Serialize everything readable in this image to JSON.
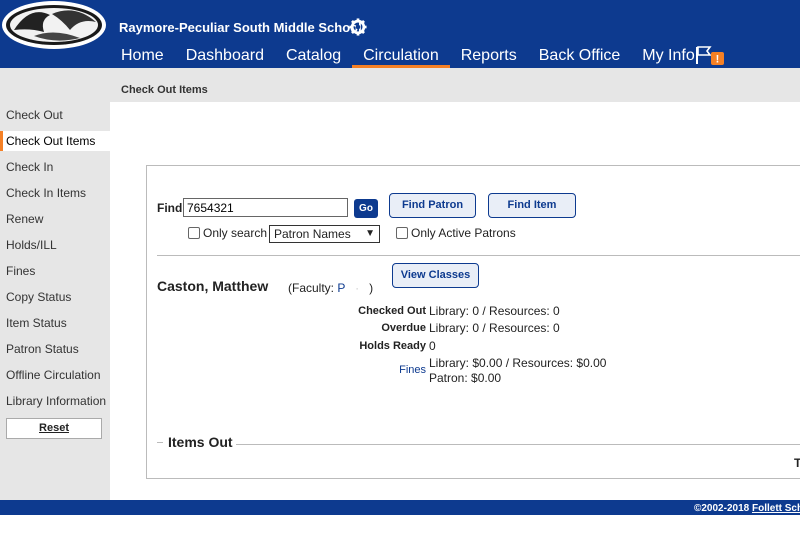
{
  "header": {
    "school_name": "Raymore-Peculiar South Middle School",
    "nav": [
      {
        "label": "Home"
      },
      {
        "label": "Dashboard"
      },
      {
        "label": "Catalog"
      },
      {
        "label": "Circulation"
      },
      {
        "label": "Reports"
      },
      {
        "label": "Back Office"
      },
      {
        "label": "My Info"
      }
    ],
    "active_nav": "Circulation",
    "alert_badge": "!"
  },
  "breadcrumb": "Check Out Items",
  "sidebar": {
    "items": [
      {
        "label": "Check Out"
      },
      {
        "label": "Check Out Items"
      },
      {
        "label": "Check In"
      },
      {
        "label": "Check In Items"
      },
      {
        "label": "Renew"
      },
      {
        "label": "Holds/ILL"
      },
      {
        "label": "Fines"
      },
      {
        "label": "Copy Status"
      },
      {
        "label": "Item Status"
      },
      {
        "label": "Patron Status"
      },
      {
        "label": "Offline Circulation"
      },
      {
        "label": "Library Information"
      }
    ],
    "active_item": "Check Out Items",
    "reset_label": "Reset"
  },
  "find": {
    "label": "Find",
    "value": "7654321",
    "go_label": "Go",
    "find_patron_label": "Find Patron",
    "find_item_label": "Find Item",
    "only_search_label": "Only search",
    "search_scope": "Patron Names",
    "only_active_label": "Only Active Patrons"
  },
  "patron": {
    "name": "Caston, Matthew",
    "type_prefix": "(Faculty:",
    "type_link": "P",
    "type_suffix": ")",
    "view_classes_label": "View Classes",
    "stats": [
      {
        "label": "Checked Out",
        "value": "Library: 0 / Resources: 0"
      },
      {
        "label": "Overdue",
        "value": "Library: 0 / Resources: 0"
      },
      {
        "label": "Holds Ready",
        "value": "0"
      },
      {
        "label": "Fines",
        "value": "Library: $0.00 / Resources: $0.00",
        "value2": "Patron: $0.00"
      }
    ]
  },
  "items_out_title": "Items Out",
  "truncated_right_text": "T",
  "footer": {
    "copyright": "©2002-2018",
    "company": "Follett Sch"
  },
  "colors": {
    "brand": "#0d3a8f",
    "accent": "#f58025",
    "sidebar_bg": "#e6e6e6"
  }
}
